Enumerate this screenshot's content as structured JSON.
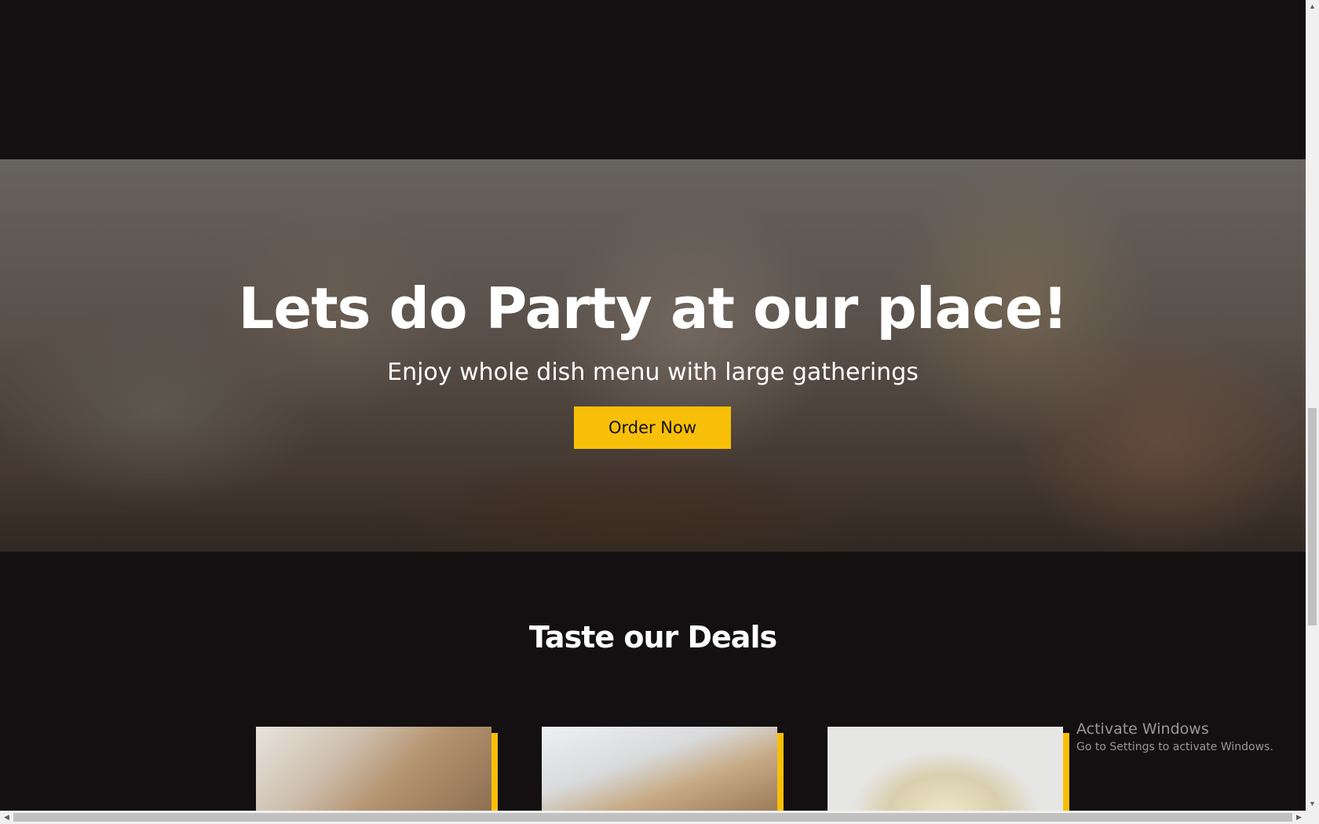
{
  "hero": {
    "title": "Lets do Party at our place!",
    "subtitle": "Enjoy whole dish menu with large gatherings",
    "button_label": "Order Now"
  },
  "deals": {
    "title": "Taste our Deals",
    "cards": [
      {
        "image": "cheese-bread-platter"
      },
      {
        "image": "sliced-bread"
      },
      {
        "image": "pasta-plate"
      }
    ]
  },
  "watermark": {
    "title": "Activate Windows",
    "subtitle": "Go to Settings to activate Windows."
  },
  "colors": {
    "background": "#141011",
    "accent": "#f8bf08",
    "text": "#ffffff"
  }
}
